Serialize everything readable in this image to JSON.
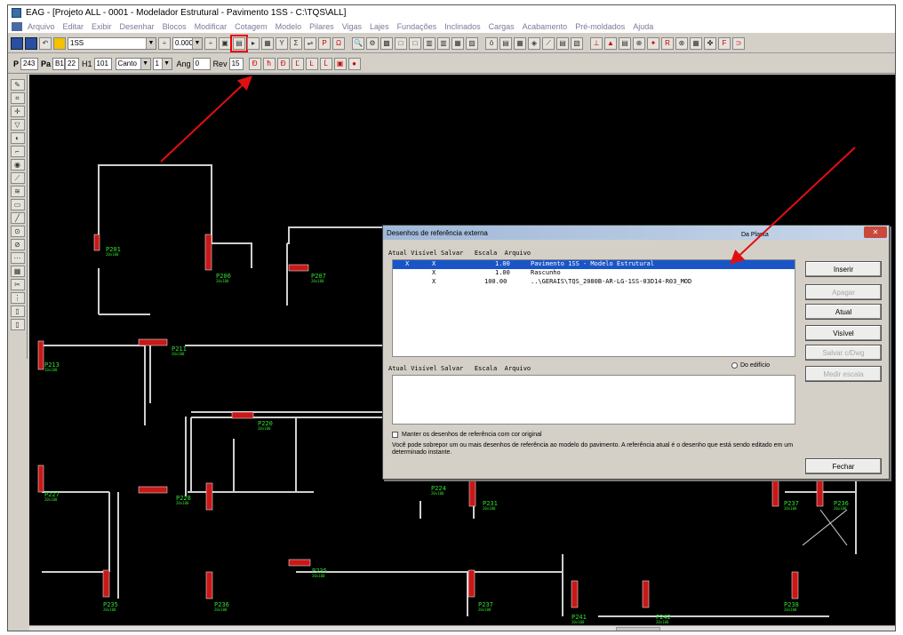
{
  "window": {
    "title": "EAG - [Projeto ALL - 0001 - Modelador Estrutural - Pavimento 1SS - C:\\TQS\\ALL]"
  },
  "menu": [
    "Arquivo",
    "Editar",
    "Exibir",
    "Desenhar",
    "Blocos",
    "Modificar",
    "Cotagem",
    "Modelo",
    "Pilares",
    "Vigas",
    "Lajes",
    "Fundações",
    "Inclinados",
    "Cargas",
    "Acabamento",
    "Pré-moldados",
    "Ajuda"
  ],
  "toolbar": {
    "floor_combo": "1SS",
    "level_combo": "0.000"
  },
  "toolbar2": {
    "p_label": "P",
    "p_value": "243",
    "pa_label": "Pa",
    "b1_value": "B1",
    "b1_num": "22",
    "h1_label": "H1",
    "h1_value": "101",
    "canto_combo": "Canto",
    "one_combo": "1",
    "ang_label": "Ang",
    "ang_value": "0",
    "rev_label": "Rev",
    "rev_value": "15"
  },
  "pillars": [
    {
      "name": "P201",
      "sub": "20x100"
    },
    {
      "name": "P206",
      "sub": "20x100"
    },
    {
      "name": "P207",
      "sub": "20x100"
    },
    {
      "name": "P211",
      "sub": "20x100"
    },
    {
      "name": "P213",
      "sub": "20x100"
    },
    {
      "name": "P220",
      "sub": "20x100"
    },
    {
      "name": "P227",
      "sub": "20x100"
    },
    {
      "name": "P228",
      "sub": "20x100"
    },
    {
      "name": "P224",
      "sub": "20x100"
    },
    {
      "name": "P231",
      "sub": "20x100"
    },
    {
      "name": "P237",
      "sub": "20x100"
    },
    {
      "name": "P236",
      "sub": "20x100"
    },
    {
      "name": "P235",
      "sub": "20x100"
    },
    {
      "name": "P235",
      "sub": "20x100"
    },
    {
      "name": "P236",
      "sub": "20x100"
    },
    {
      "name": "P237",
      "sub": "20x100"
    },
    {
      "name": "P241",
      "sub": "20x100"
    },
    {
      "name": "P242",
      "sub": "20x100"
    },
    {
      "name": "P238",
      "sub": "20x100"
    }
  ],
  "dialog": {
    "title": "Desenhos de referência externa",
    "radio_planta": "Da Planta",
    "radio_edificio": "Do edifício",
    "header1": "Atual Visível Salvar   Escala  Arquivo",
    "header2": "Atual Visível Salvar   Escala  Arquivo",
    "rows": [
      {
        "atual": "X",
        "visivel": "X",
        "escala": "1.00",
        "arquivo": "Pavimento 1SS - Modelo Estrutural",
        "selected": true
      },
      {
        "atual": "",
        "visivel": "X",
        "escala": "1.00",
        "arquivo": "Rascunho",
        "selected": false
      },
      {
        "atual": "",
        "visivel": "X",
        "escala": "100.00",
        "arquivo": "..\\GERAIS\\TQS_2080B-AR-LG-1SS-03D14-R03_MOD",
        "selected": false
      }
    ],
    "checkbox_label": "Manter os desenhos de referência com cor original",
    "description": "Você pode sobrepor um ou mais desenhos de referência ao modelo do pavimento. A referência atual é o desenho que está sendo editado em um determinado instante.",
    "buttons": {
      "inserir": "Inserir",
      "apagar": "Apagar",
      "atual": "Atual",
      "visivel": "Visível",
      "salvar": "Salvar c/Dwg",
      "medir": "Medir escala",
      "fechar": "Fechar"
    }
  },
  "colors": {
    "canvas_bg": "#000000",
    "pillar_fill": "#c81818",
    "label_green": "#32e032",
    "arrow_red": "#e01010",
    "selection_blue": "#1a55c8"
  }
}
